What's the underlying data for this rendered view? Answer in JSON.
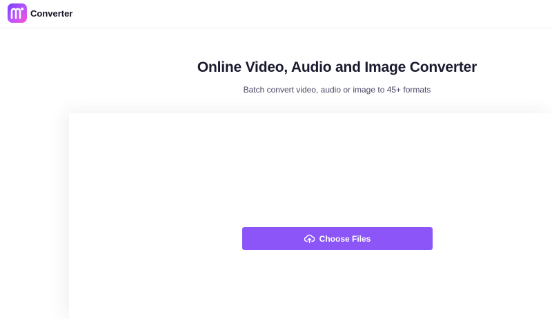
{
  "header": {
    "brand": "Converter",
    "logo_letter": "m",
    "colors": {
      "logo_start": "#7b3cff",
      "logo_end": "#ff4fd8"
    }
  },
  "hero": {
    "title": "Online Video, Audio and Image Converter",
    "subtitle": "Batch convert video, audio or image to 45+ formats"
  },
  "upload": {
    "button_label": "Choose Files",
    "button_icon": "cloud-upload-icon",
    "colors": {
      "button_bg": "#8b55f7"
    }
  }
}
